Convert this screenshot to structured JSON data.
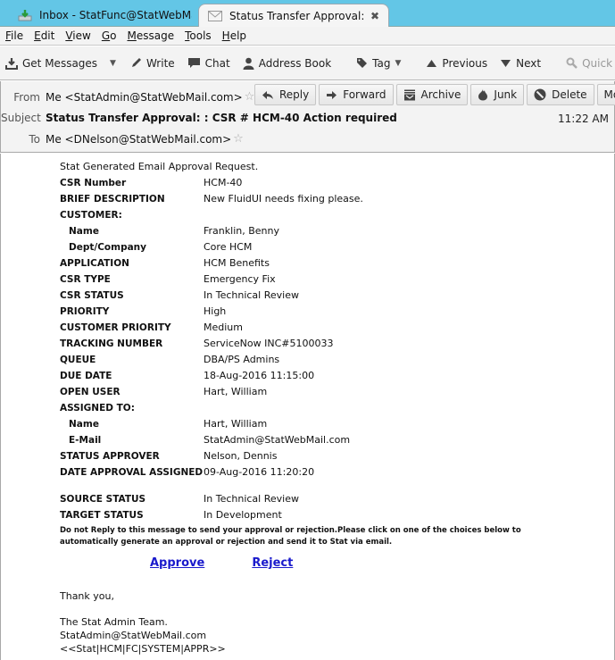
{
  "tabs": [
    {
      "label": "Inbox - StatFunc@StatWebMa...",
      "icon": "inbox-download-icon",
      "active": false
    },
    {
      "label": "Status Transfer Approval: : ...",
      "icon": "envelope-icon",
      "active": true,
      "close": "✖"
    }
  ],
  "menubar": {
    "items": [
      {
        "label": "File",
        "accel": "F",
        "rest": "ile"
      },
      {
        "label": "Edit",
        "accel": "E",
        "rest": "dit"
      },
      {
        "label": "View",
        "accel": "V",
        "rest": "iew"
      },
      {
        "label": "Go",
        "accel": "G",
        "rest": "o"
      },
      {
        "label": "Message",
        "accel": "M",
        "rest": "essage"
      },
      {
        "label": "Tools",
        "accel": "T",
        "rest": "ools"
      },
      {
        "label": "Help",
        "accel": "H",
        "rest": "elp"
      }
    ]
  },
  "toolbar": {
    "get_messages": "Get Messages",
    "write": "Write",
    "chat": "Chat",
    "address_book": "Address Book",
    "tag": "Tag",
    "previous": "Previous",
    "next": "Next",
    "quick_filter": "Quick Filter"
  },
  "header": {
    "from_label": "From",
    "from_value": "Me <StatAdmin@StatWebMail.com>",
    "subject_label": "Subject",
    "subject_value": "Status Transfer Approval: : CSR # HCM-40 Action required",
    "to_label": "To",
    "to_value": "Me <DNelson@StatWebMail.com>",
    "time": "11:22 AM",
    "buttons": {
      "reply": "Reply",
      "forward": "Forward",
      "archive": "Archive",
      "junk": "Junk",
      "delete": "Delete",
      "more": "More"
    }
  },
  "message": {
    "intro": "Stat Generated Email Approval Request.",
    "fields": [
      {
        "key": "CSR Number",
        "value": "HCM-40",
        "indent": false
      },
      {
        "key": "BRIEF DESCRIPTION",
        "value": "New FluidUI needs fixing please.",
        "indent": false
      },
      {
        "key": "CUSTOMER:",
        "value": "",
        "indent": false
      },
      {
        "key": "Name",
        "value": "Franklin, Benny",
        "indent": true
      },
      {
        "key": "Dept/Company",
        "value": "Core HCM",
        "indent": true
      },
      {
        "key": "APPLICATION",
        "value": "HCM Benefits",
        "indent": false
      },
      {
        "key": "CSR TYPE",
        "value": "Emergency Fix",
        "indent": false
      },
      {
        "key": "CSR STATUS",
        "value": "In Technical Review",
        "indent": false
      },
      {
        "key": "PRIORITY",
        "value": "High",
        "indent": false
      },
      {
        "key": "CUSTOMER PRIORITY",
        "value": "Medium",
        "indent": false
      },
      {
        "key": "TRACKING NUMBER",
        "value": "ServiceNow INC#5100033",
        "indent": false
      },
      {
        "key": "QUEUE",
        "value": "DBA/PS Admins",
        "indent": false
      },
      {
        "key": "DUE DATE",
        "value": "18-Aug-2016 11:15:00",
        "indent": false
      },
      {
        "key": "OPEN USER",
        "value": "Hart, William",
        "indent": false
      },
      {
        "key": "ASSIGNED TO:",
        "value": "",
        "indent": false
      },
      {
        "key": "Name",
        "value": "Hart, William",
        "indent": true
      },
      {
        "key": "E-Mail",
        "value": "StatAdmin@StatWebMail.com",
        "indent": true
      },
      {
        "key": "STATUS APPROVER",
        "value": "Nelson, Dennis",
        "indent": false
      },
      {
        "key": "DATE APPROVAL ASSIGNED",
        "value": "09-Aug-2016 11:20:20",
        "indent": false
      }
    ],
    "status_fields": [
      {
        "key": "SOURCE STATUS",
        "value": "In Technical Review"
      },
      {
        "key": "TARGET STATUS",
        "value": "In Development"
      }
    ],
    "notice": "Do not Reply to this message to send your approval or rejection.Please click on one of the choices below to automatically generate an approval or rejection and send it to Stat via email.",
    "approve_link": "Approve",
    "reject_link": "Reject",
    "thanks": "Thank you,",
    "signature": [
      "The Stat Admin Team.",
      "StatAdmin@StatWebMail.com",
      "<<Stat|HCM|FC|SYSTEM|APPR>>"
    ]
  },
  "colors": {
    "tabbar_bg": "#63c6e6",
    "link": "#1a1acc"
  }
}
